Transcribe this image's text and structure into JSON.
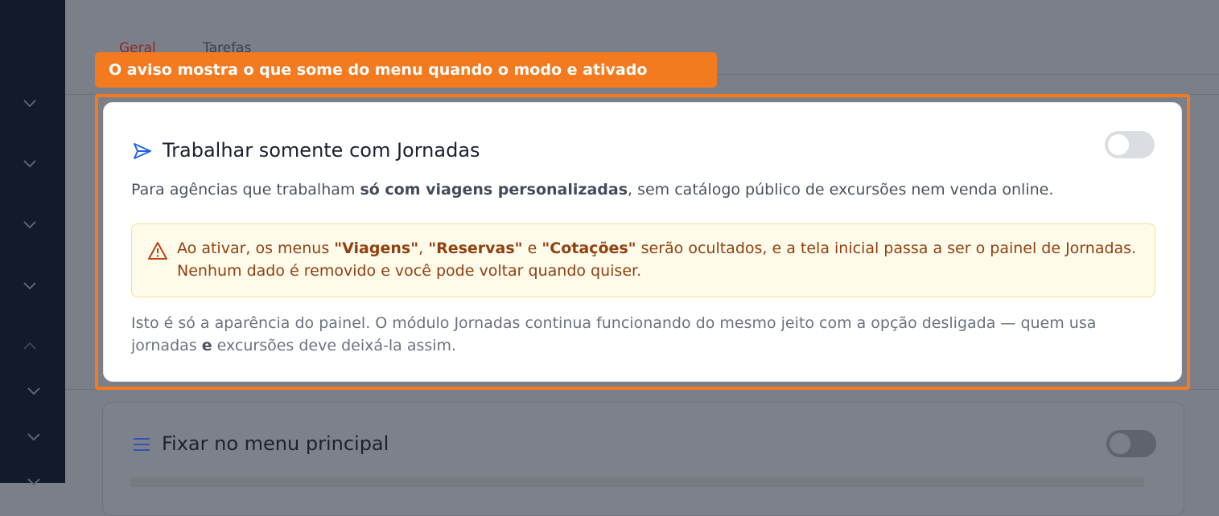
{
  "tabs": [
    {
      "label": "Geral",
      "active": true
    },
    {
      "label": "Tarefas",
      "active": false
    }
  ],
  "tooltip": {
    "text": "O aviso mostra o que some do menu quando o modo e ativado"
  },
  "journeys_card": {
    "icon": "send-icon",
    "title": "Trabalhar somente com Jornadas",
    "toggle_on": false,
    "desc_before": "Para agências que trabalham ",
    "desc_bold": "só com viagens personalizadas",
    "desc_after": ", sem catálogo público de excursões nem venda online.",
    "warning": {
      "icon": "warning-icon",
      "prefix": "Ao ativar, os menus ",
      "menu1": "\"Viagens\"",
      "sep1": ", ",
      "menu2": "\"Reservas\"",
      "sep2": " e ",
      "menu3": "\"Cotações\"",
      "suffix": " serão ocultados, e a tela inicial passa a ser o painel de Jornadas. Nenhum dado é removido e você pode voltar quando quiser."
    },
    "note_before": "Isto é só a aparência do painel. O módulo Jornadas continua funcionando do mesmo jeito com a opção desligada — quem usa jornadas ",
    "note_bold": "e",
    "note_after": " excursões deve deixá-la assim."
  },
  "pin_card": {
    "icon": "menu-lines-icon",
    "title": "Fixar no menu principal",
    "toggle_on": false
  },
  "colors": {
    "accent": "#f47a1f",
    "sidebar": "#131a2c",
    "warning_text": "#92400e",
    "icon_blue": "#2563eb"
  }
}
